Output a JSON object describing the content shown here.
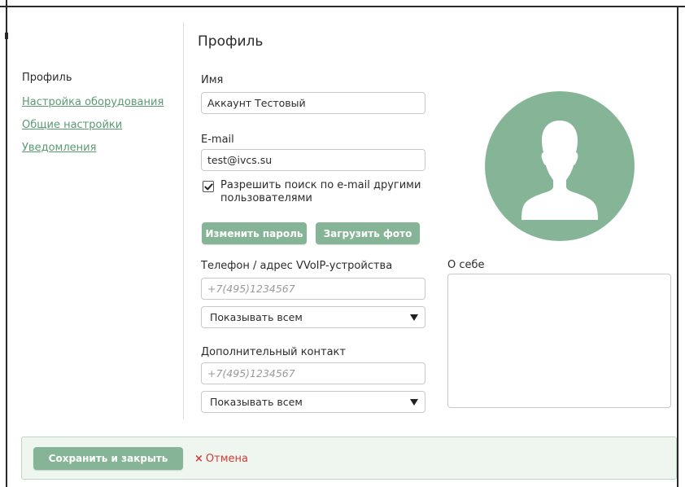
{
  "page": {
    "heading": "Профиль"
  },
  "sidebar": {
    "items": [
      {
        "label": "Профиль",
        "active": true
      },
      {
        "label": "Настройка оборудования",
        "active": false
      },
      {
        "label": "Общие настройки",
        "active": false
      },
      {
        "label": "Уведомления",
        "active": false
      }
    ]
  },
  "form": {
    "name_label": "Имя",
    "name_value": "Аккаунт Тестовый",
    "email_label": "E-mail",
    "email_value": "test@ivcs.su",
    "search_checkbox_label": "Разрешить поиск по e-mail другими пользователями",
    "search_checkbox_checked": true,
    "change_password_button": "Изменить пароль",
    "upload_photo_button": "Загрузить фото",
    "phone_label": "Телефон / адрес VVoIP-устройства",
    "phone_placeholder": "+7(495)1234567",
    "phone_visibility": "Показывать всем",
    "extra_contact_label": "Дополнительный контакт",
    "extra_contact_placeholder": "+7(495)1234567",
    "extra_contact_visibility": "Показывать всем",
    "about_label": "О себе",
    "about_value": ""
  },
  "footer": {
    "save_button": "Сохранить и закрыть",
    "cancel_link": "Отмена",
    "cancel_icon": "×"
  },
  "colors": {
    "accent": "#85b596",
    "link": "#5a9a72",
    "cancel": "#d23b3b",
    "footer_bg": "#eef6ef"
  },
  "icons": {
    "avatar": "user-silhouette-icon",
    "checkbox": "check-icon",
    "select": "caret-down-icon",
    "cancel": "close-icon"
  }
}
